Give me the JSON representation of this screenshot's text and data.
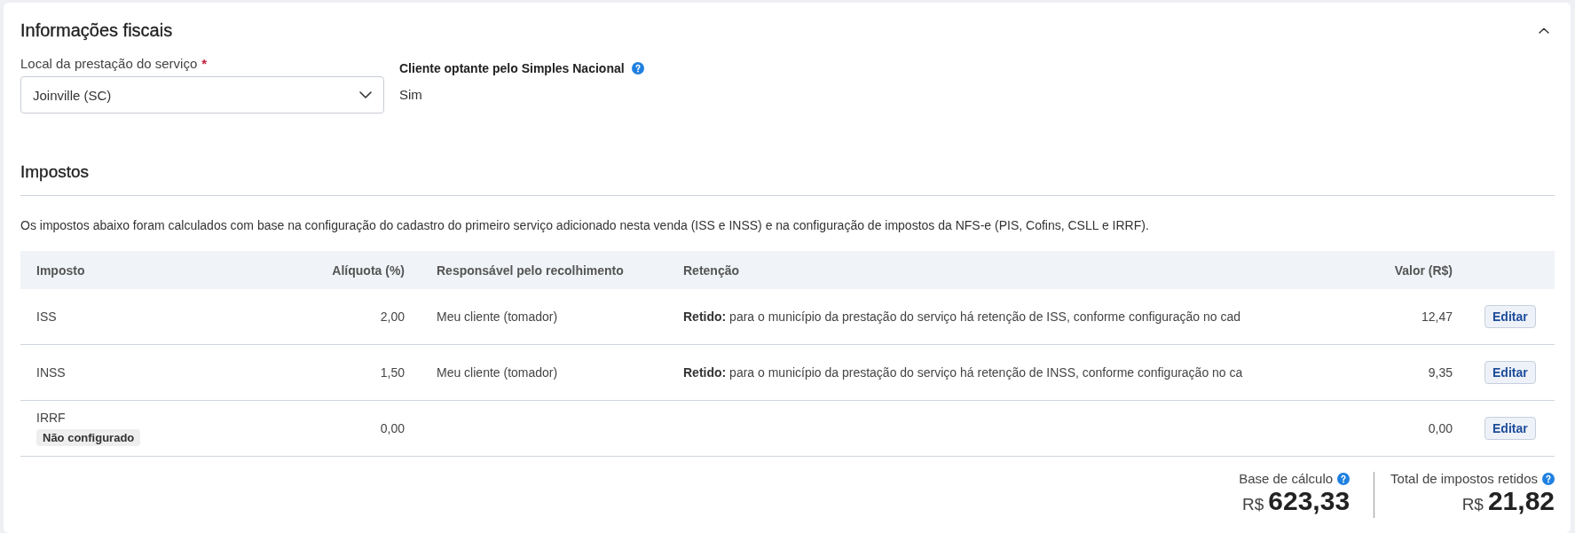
{
  "section": {
    "title": "Informações fiscais",
    "expanded": true
  },
  "service_location": {
    "label": "Local da prestação do serviço",
    "required_mark": "*",
    "value": "Joinville (SC)"
  },
  "simples_nacional": {
    "label": "Cliente optante pelo Simples Nacional",
    "value": "Sim"
  },
  "taxes": {
    "title": "Impostos",
    "description": "Os impostos abaixo foram calculados com base na configuração do cadastro do primeiro serviço adicionado nesta venda (ISS e INSS) e na configuração de impostos da NFS-e (PIS, Cofins, CSLL e IRRF)."
  },
  "table": {
    "columns": [
      "Imposto",
      "Alíquota (%)",
      "Responsável pelo recolhimento",
      "Retenção",
      "Valor (R$)"
    ],
    "rows": [
      {
        "tax": "ISS",
        "rate": "2,00",
        "responsible": "Meu cliente (tomador)",
        "retention": "**Retido:** para o município da prestação do serviço há retenção de ISS, conforme configuração no cad",
        "value": "12,47",
        "action": "Editar"
      },
      {
        "tax": "INSS",
        "rate": "1,50",
        "responsible": "Meu cliente (tomador)",
        "retention": "**Retido:** para o município da prestação do serviço há retenção de INSS, conforme configuração no ca",
        "value": "9,35",
        "action": "Editar"
      },
      {
        "tax": "IRRF",
        "status": "Não configurado",
        "rate": "0,00",
        "value": "0,00",
        "action": "Editar"
      }
    ]
  },
  "summary": [
    {
      "label": "Base de cálculo",
      "currency": "R$",
      "amount": "623,33"
    },
    {
      "label": "Total de impostos retidos",
      "currency": "R$",
      "amount": "21,82"
    }
  ]
}
